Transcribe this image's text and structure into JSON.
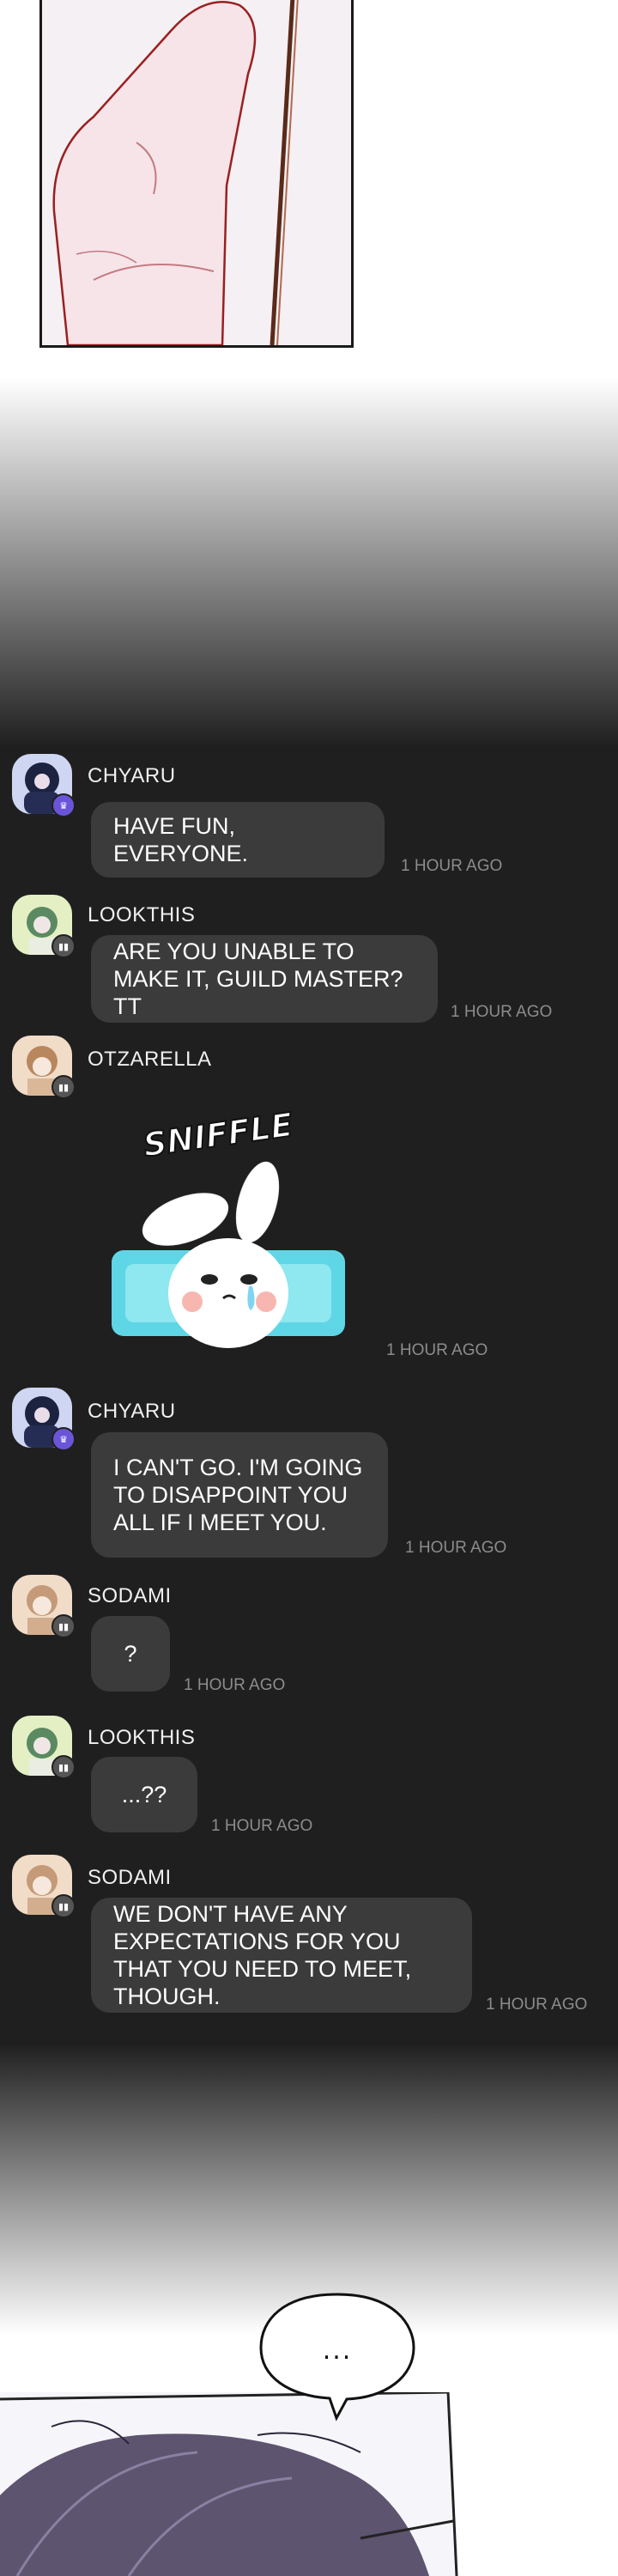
{
  "chat": {
    "messages": [
      {
        "user": "CHYARU",
        "badge": "crown-badge-icon",
        "text": "HAVE FUN, EVERYONE.",
        "time": "1 HOUR AGO"
      },
      {
        "user": "LOOKTHIS",
        "badge": "member-badge-icon",
        "text": "ARE YOU UNABLE TO MAKE IT, GUILD MASTER? TT",
        "time": "1 HOUR AGO"
      },
      {
        "user": "OTZARELLA",
        "badge": "member-badge-icon",
        "sticker": {
          "caption": "SNIFFLE",
          "icon": "crying-bunny-sticker-icon"
        },
        "time": "1 HOUR AGO"
      },
      {
        "user": "CHYARU",
        "badge": "crown-badge-icon",
        "text": "I CAN'T GO. I'M GOING TO DISAPPOINT YOU ALL IF I MEET YOU.",
        "time": "1 HOUR AGO"
      },
      {
        "user": "SODAMI",
        "badge": "member-badge-icon",
        "text": "?",
        "time": "1 HOUR AGO"
      },
      {
        "user": "LOOKTHIS",
        "badge": "member-badge-icon",
        "text": "...??",
        "time": "1 HOUR AGO"
      },
      {
        "user": "SODAMI",
        "badge": "member-badge-icon",
        "text": "WE DON'T HAVE ANY EXPECTATIONS FOR YOU THAT YOU NEED TO MEET, THOUGH.",
        "time": "1 HOUR AGO"
      }
    ]
  },
  "speech_bubble": {
    "text": "..."
  },
  "colors": {
    "chat_background": "#1f1f1f",
    "bubble": "#3b3b3b",
    "timestamp": "#8c8c8c",
    "crown_badge": "#6a55d8"
  }
}
